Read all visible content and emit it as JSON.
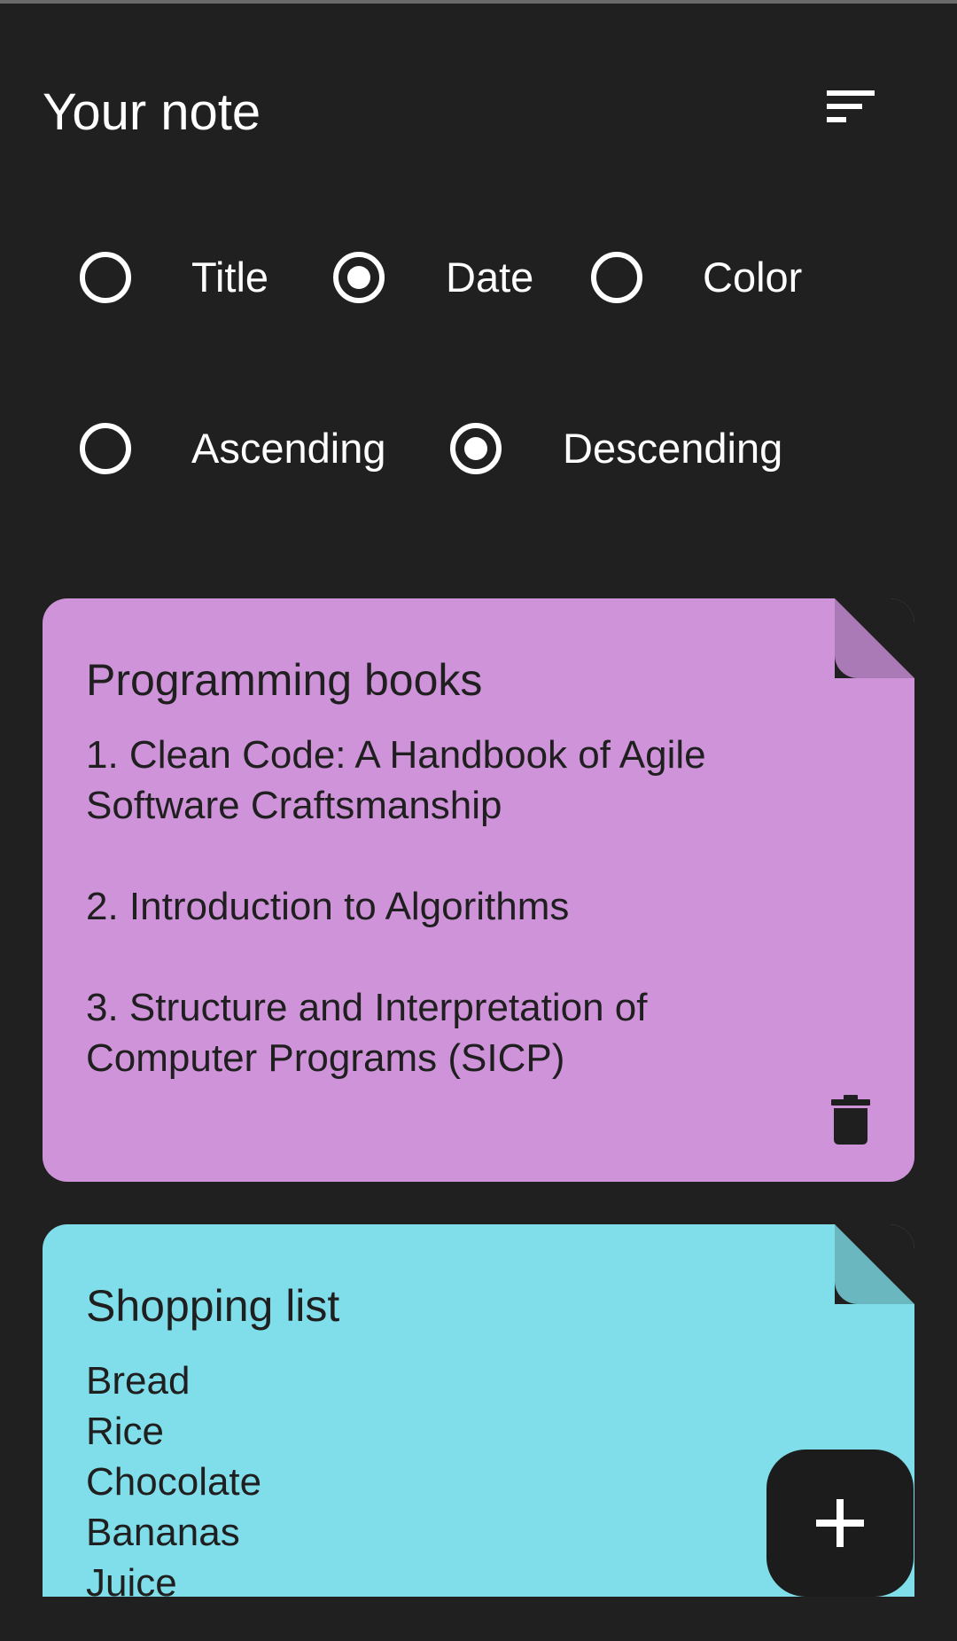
{
  "app": {
    "title": "Your note"
  },
  "sort_options": {
    "order": [
      {
        "label": "Title",
        "checked": false
      },
      {
        "label": "Date",
        "checked": true
      },
      {
        "label": "Color",
        "checked": false
      }
    ],
    "direction": [
      {
        "label": "Ascending",
        "checked": false
      },
      {
        "label": "Descending",
        "checked": true
      }
    ]
  },
  "notes": [
    {
      "title": "Programming books",
      "content": "1. Clean Code: A Handbook of Agile\nSoftware Craftsmanship\n\n2. Introduction to Algorithms\n\n3. Structure and Interpretation of\nComputer Programs (SICP)",
      "color": "#CF93D9",
      "fold_color": "#A97AB5"
    },
    {
      "title": "Shopping list",
      "content": "Bread\nRice\nChocolate\nBananas\nJuice",
      "color": "#80DEEA",
      "fold_color": "#6AB7C0"
    }
  ],
  "icons": {
    "sort": "sort-icon",
    "delete": "trash-icon",
    "add": "plus-icon"
  },
  "colors": {
    "background": "#202020",
    "fab_background": "#1C1C1C",
    "foreground": "#FFFFFF"
  }
}
